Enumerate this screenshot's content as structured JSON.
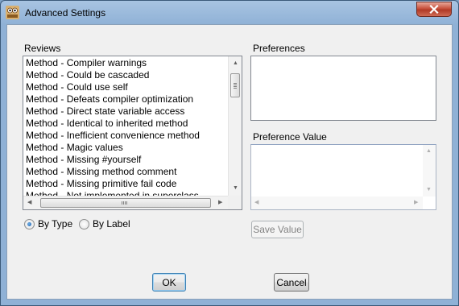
{
  "window": {
    "title": "Advanced Settings"
  },
  "reviews": {
    "label": "Reviews",
    "items": [
      "Method - Compiler warnings",
      "Method - Could be cascaded",
      "Method - Could use self",
      "Method - Defeats compiler optimization",
      "Method - Direct state variable access",
      "Method - Identical to inherited method",
      "Method - Inefficient convenience method",
      "Method - Magic values",
      "Method - Missing #yourself",
      "Method - Missing method comment",
      "Method - Missing primitive fail code",
      "Method - Not implemented in superclass"
    ]
  },
  "preferences": {
    "label": "Preferences"
  },
  "preference_value": {
    "label": "Preference Value",
    "value": ""
  },
  "sort": {
    "options": [
      {
        "label": "By Type",
        "selected": true
      },
      {
        "label": "By Label",
        "selected": false
      }
    ]
  },
  "buttons": {
    "save_value": "Save Value",
    "ok": "OK",
    "cancel": "Cancel"
  },
  "icons": {
    "app": "squeak-app-icon",
    "close": "close-icon",
    "scroll_up": "up-arrow-icon",
    "scroll_down": "down-arrow-icon",
    "scroll_left": "left-arrow-icon",
    "scroll_right": "right-arrow-icon"
  }
}
